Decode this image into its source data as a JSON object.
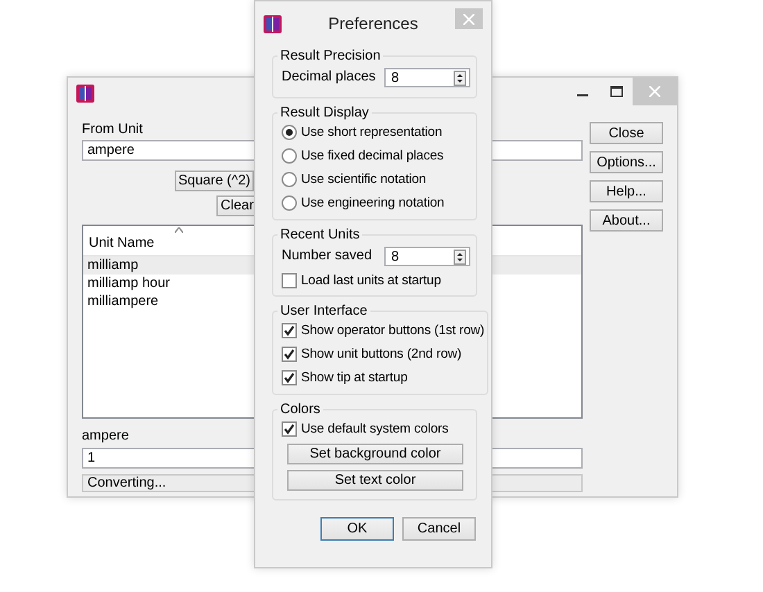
{
  "main_window": {
    "from_unit_label": "From Unit",
    "from_unit_value": "ampere",
    "square_button": "Square (^2)",
    "clear_button": "Clear",
    "list": {
      "column": "Unit Name",
      "rows": [
        {
          "name": "milliamp",
          "selected": true
        },
        {
          "name": "milliamp hour",
          "selected": false
        },
        {
          "name": "milliampere",
          "selected": false
        }
      ]
    },
    "to_label": "ampere",
    "to_value": "1",
    "status": "Converting...",
    "buttons": [
      "Close",
      "Options...",
      "Help...",
      "About..."
    ]
  },
  "dialog": {
    "title": "Preferences",
    "groups": [
      {
        "title": "Result Precision",
        "items": [
          {
            "kind": "spin",
            "label": "Decimal places",
            "value": "8"
          }
        ]
      },
      {
        "title": "Result Display",
        "items": [
          {
            "kind": "radio",
            "label": "Use short representation",
            "selected": true
          },
          {
            "kind": "radio",
            "label": "Use fixed decimal places",
            "selected": false
          },
          {
            "kind": "radio",
            "label": "Use scientific notation",
            "selected": false
          },
          {
            "kind": "radio",
            "label": "Use engineering notation",
            "selected": false
          }
        ]
      },
      {
        "title": "Recent Units",
        "items": [
          {
            "kind": "spin",
            "label": "Number saved",
            "value": "8"
          },
          {
            "kind": "checkbox",
            "label": "Load last units at startup",
            "checked": false
          }
        ]
      },
      {
        "title": "User Interface",
        "items": [
          {
            "kind": "checkbox",
            "label": "Show operator buttons (1st row)",
            "checked": true
          },
          {
            "kind": "checkbox",
            "label": "Show unit buttons (2nd row)",
            "checked": true
          },
          {
            "kind": "checkbox",
            "label": "Show tip at startup",
            "checked": true
          }
        ]
      },
      {
        "title": "Colors",
        "items": [
          {
            "kind": "checkbox",
            "label": "Use default system colors",
            "checked": true
          },
          {
            "kind": "button",
            "label": "Set background color"
          },
          {
            "kind": "button",
            "label": "Set text color"
          }
        ]
      }
    ],
    "buttons": [
      {
        "label": "OK",
        "default": true
      },
      {
        "label": "Cancel",
        "default": false
      }
    ]
  }
}
